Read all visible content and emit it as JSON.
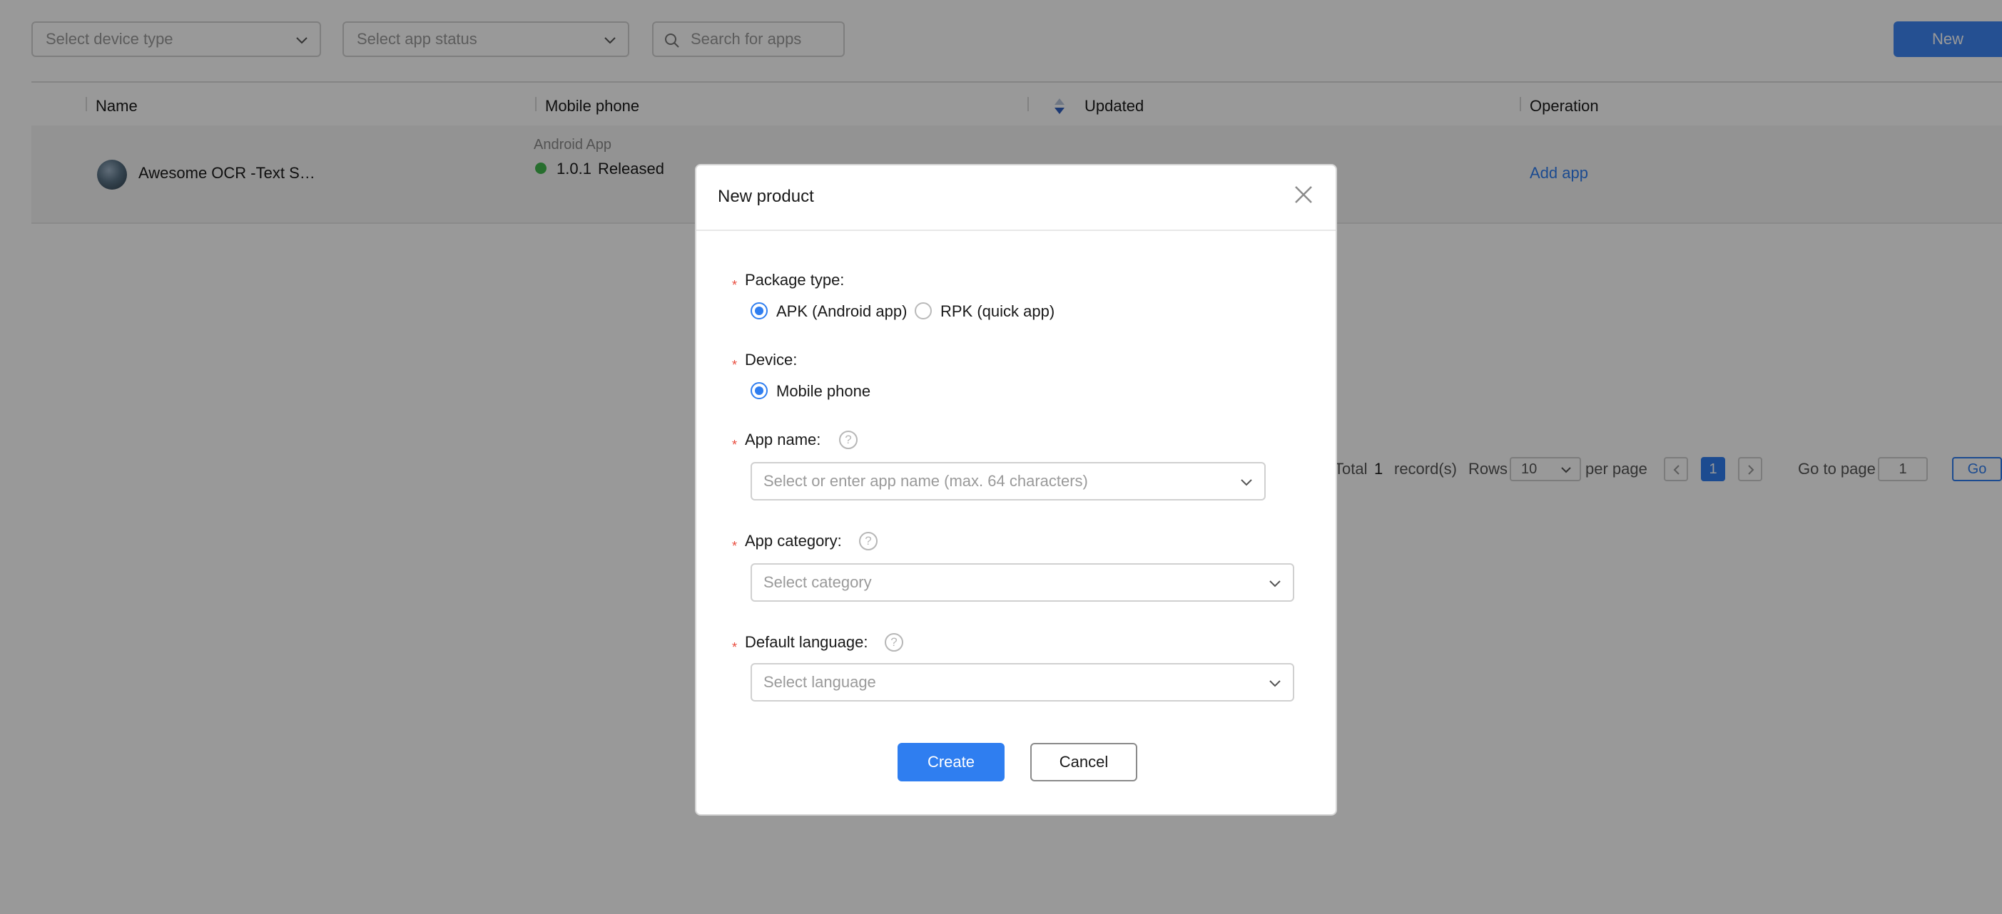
{
  "toolbar": {
    "device_type_placeholder": "Select device type",
    "app_status_placeholder": "Select app status",
    "search_placeholder": "Search for apps",
    "new_label": "New"
  },
  "table": {
    "columns": [
      "Name",
      "Mobile phone",
      "Updated",
      "Operation"
    ],
    "rows": [
      {
        "name": "Awesome OCR -Text S…",
        "platform": "Android App",
        "version": "1.0.1",
        "status": "Released",
        "status_color": "#41b84e",
        "operation": "Add app"
      }
    ]
  },
  "pagination": {
    "total_label": "Total",
    "total": "1",
    "records_label": "record(s)",
    "rows_label": "Rows",
    "rows_per_page": "10",
    "per_page_label": "per page",
    "current_page": "1",
    "goto_label": "Go to page",
    "goto_value": "1",
    "go_label": "Go"
  },
  "dialog": {
    "title": "New product",
    "required_mark": "*",
    "package_type": {
      "label": "Package type:",
      "options": [
        "APK (Android app)",
        "RPK (quick app)"
      ],
      "selected": "APK (Android app)"
    },
    "device": {
      "label": "Device:",
      "options": [
        "Mobile phone"
      ],
      "selected": "Mobile phone"
    },
    "app_name": {
      "label": "App name:",
      "placeholder": "Select or enter app name (max. 64 characters)"
    },
    "app_category": {
      "label": "App category:",
      "placeholder": "Select category"
    },
    "default_language": {
      "label": "Default language:",
      "placeholder": "Select language"
    },
    "help_glyph": "?",
    "create_label": "Create",
    "cancel_label": "Cancel"
  },
  "colors": {
    "accent": "#2f7ef0",
    "overlay": "rgba(0,0,0,0.40)",
    "required": "#e84a3c"
  }
}
